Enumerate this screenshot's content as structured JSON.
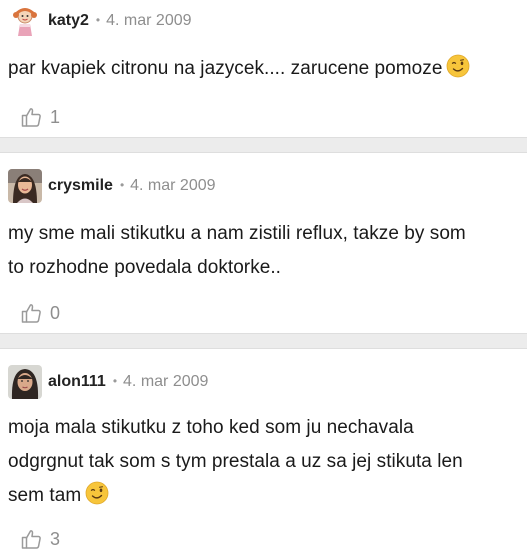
{
  "comments": [
    {
      "author": "katy2",
      "separator": "•",
      "date": "4. mar 2009",
      "text": "par kvapiek citronu na jazycek.... zarucene pomoze",
      "emoji": "winking-face",
      "likes": "1"
    },
    {
      "author": "crysmile",
      "separator": "•",
      "date": "4. mar 2009",
      "text_lines": [
        "my sme mali stikutku a nam zistili reflux, takze by som",
        "to rozhodne povedala doktorke.."
      ],
      "likes": "0"
    },
    {
      "author": "alon111",
      "separator": "•",
      "date": "4. mar 2009",
      "text_lines": [
        "moja mala stikutku z toho ked som ju nechavala",
        "odgrgnut tak som s tym prestala a uz sa jej stikuta len",
        "sem tam"
      ],
      "emoji": "winking-face",
      "likes": "3"
    }
  ],
  "colors": {
    "divider": "#ececec",
    "meta_gray": "#8e8e8e",
    "emoji_yellow": "#f7c53b"
  }
}
